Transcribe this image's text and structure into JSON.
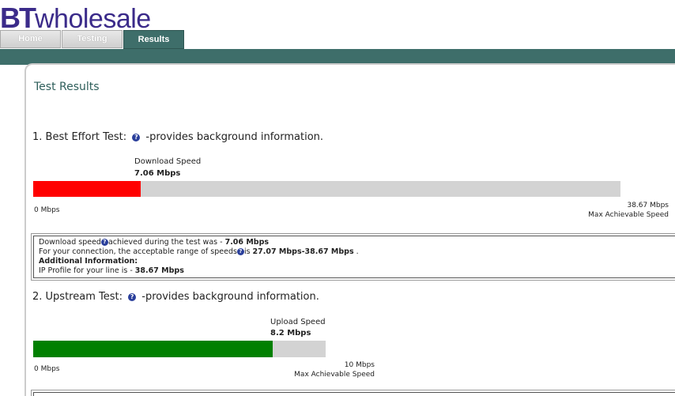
{
  "header": {
    "logo_bt": "BT",
    "logo_wholesale": "wholesale"
  },
  "tabs": [
    {
      "label": "Home",
      "active": false
    },
    {
      "label": "Testing",
      "active": false
    },
    {
      "label": "Results",
      "active": true
    }
  ],
  "colors": {
    "accent": "#3e6e6a",
    "download_bar": "#ff0000",
    "upload_bar": "#008000",
    "bar_track": "#d3d3d3",
    "logo": "#3b2b8a"
  },
  "page_title": "Test Results",
  "best_effort": {
    "title_prefix": "1. Best Effort Test:",
    "title_suffix": "-provides background information.",
    "speed_label": "Download Speed",
    "speed_value": "7.06 Mbps",
    "measured": 7.06,
    "max": 38.67,
    "axis_min": "0 Mbps",
    "axis_max": "38.67 Mbps",
    "axis_max_caption": "Max Achievable Speed",
    "info": {
      "line1_prefix": "Download speed",
      "line1_middle": "achieved during the test was - ",
      "line1_value": "7.06 Mbps",
      "line2_prefix": "For your connection, the acceptable range of speeds",
      "line2_middle": "is ",
      "line2_value": "27.07 Mbps-38.67 Mbps",
      "line2_suffix": " .",
      "additional_heading": "Additional Information:",
      "ip_profile_prefix": "IP Profile for your line is - ",
      "ip_profile_value": "38.67 Mbps"
    }
  },
  "upstream": {
    "title_prefix": "2. Upstream Test:",
    "title_suffix": "-provides background information.",
    "speed_label": "Upload Speed",
    "speed_value": "8.2 Mbps",
    "measured": 8.2,
    "max": 10,
    "axis_min": "0 Mbps",
    "axis_max": "10 Mbps",
    "axis_max_caption": "Max Achievable Speed"
  }
}
